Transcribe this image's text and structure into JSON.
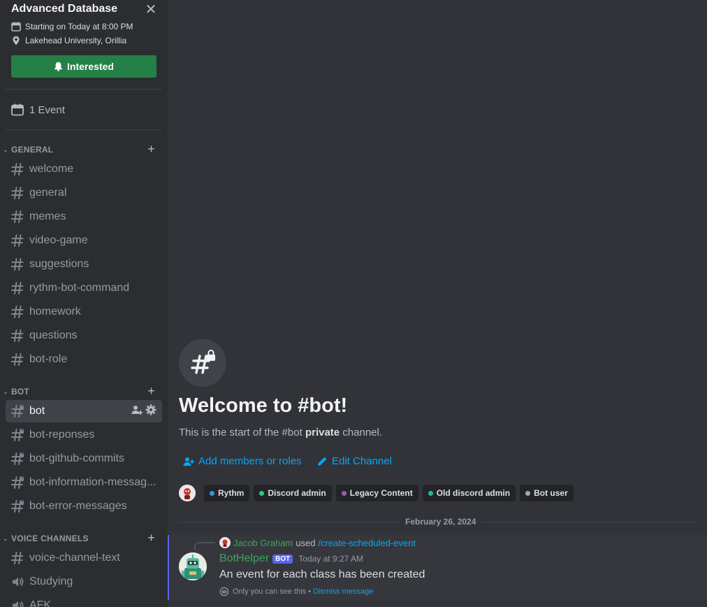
{
  "event": {
    "title": "Advanced Database",
    "time": "Starting on Today at 8:00 PM",
    "location": "Lakehead University, Orillia",
    "interested_label": "Interested",
    "events_count_label": "1 Event"
  },
  "categories": {
    "general": "GENERAL",
    "bot": "BOT",
    "voice": "VOICE CHANNELS"
  },
  "channels": {
    "general": [
      "welcome",
      "general",
      "memes",
      "video-game",
      "suggestions",
      "rythm-bot-command",
      "homework",
      "questions",
      "bot-role"
    ],
    "bot": [
      "bot",
      "bot-reponses",
      "bot-github-commits",
      "bot-information-messag...",
      "bot-error-messages"
    ],
    "voice": [
      "voice-channel-text",
      "Studying",
      "AFK"
    ]
  },
  "welcome": {
    "title": "Welcome to #bot!",
    "sub_prefix": "This is the start of the #bot ",
    "sub_bold": "private",
    "sub_suffix": " channel.",
    "add_members": "Add members or roles",
    "edit_channel": "Edit Channel"
  },
  "roles": [
    {
      "name": "Rythm",
      "color": "#3498db"
    },
    {
      "name": "Discord admin",
      "color": "#2ecc71"
    },
    {
      "name": "Legacy Content",
      "color": "#9b59b6"
    },
    {
      "name": "Old discord admin",
      "color": "#1abc9c"
    },
    {
      "name": "Bot user",
      "color": "#99aab5"
    }
  ],
  "date_divider": "February 26, 2024",
  "message": {
    "reply_user": "Jacob Graham",
    "reply_used": "used",
    "reply_command": "/create-scheduled-event",
    "author": "BotHelper",
    "bot_tag": "BOT",
    "time": "Today at 9:27 AM",
    "content": "An event for each class has been created",
    "ephemeral_note": "Only you can see this",
    "dismiss": "Dismiss message"
  },
  "colors": {
    "accent": "#5865f2",
    "interested": "#248046",
    "link": "#00a8fc",
    "username": "#3ba55d"
  }
}
